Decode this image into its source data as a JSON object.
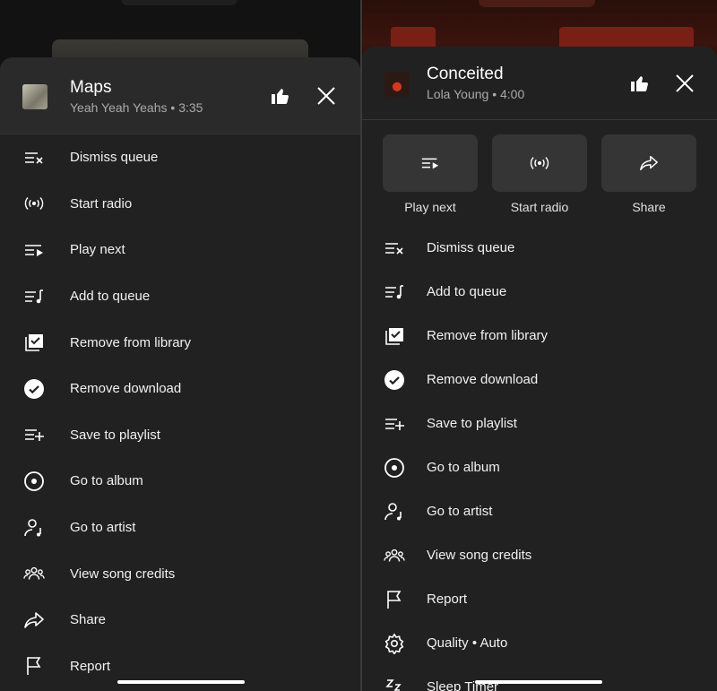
{
  "left": {
    "song": {
      "title": "Maps",
      "subtitle": "Yeah Yeah Yeahs • 3:35"
    },
    "menu": [
      {
        "label": "Dismiss queue",
        "icon": "dismiss-queue-icon"
      },
      {
        "label": "Start radio",
        "icon": "radio-icon"
      },
      {
        "label": "Play next",
        "icon": "play-next-icon"
      },
      {
        "label": "Add to queue",
        "icon": "add-to-queue-icon"
      },
      {
        "label": "Remove from library",
        "icon": "library-check-icon"
      },
      {
        "label": "Remove download",
        "icon": "download-check-icon"
      },
      {
        "label": "Save to playlist",
        "icon": "playlist-add-icon"
      },
      {
        "label": "Go to album",
        "icon": "album-icon"
      },
      {
        "label": "Go to artist",
        "icon": "artist-icon"
      },
      {
        "label": "View song credits",
        "icon": "credits-icon"
      },
      {
        "label": "Share",
        "icon": "share-icon"
      },
      {
        "label": "Report",
        "icon": "flag-icon"
      }
    ]
  },
  "right": {
    "song": {
      "title": "Conceited",
      "subtitle": "Lola Young • 4:00"
    },
    "quick_actions": [
      {
        "label": "Play next",
        "icon": "play-next-icon"
      },
      {
        "label": "Start radio",
        "icon": "radio-icon"
      },
      {
        "label": "Share",
        "icon": "share-icon"
      }
    ],
    "menu": [
      {
        "label": "Dismiss queue",
        "icon": "dismiss-queue-icon"
      },
      {
        "label": "Add to queue",
        "icon": "add-to-queue-icon"
      },
      {
        "label": "Remove from library",
        "icon": "library-check-icon"
      },
      {
        "label": "Remove download",
        "icon": "download-check-icon"
      },
      {
        "label": "Save to playlist",
        "icon": "playlist-add-icon"
      },
      {
        "label": "Go to album",
        "icon": "album-icon"
      },
      {
        "label": "Go to artist",
        "icon": "artist-icon"
      },
      {
        "label": "View song credits",
        "icon": "credits-icon"
      },
      {
        "label": "Report",
        "icon": "flag-icon"
      },
      {
        "label": "Quality • Auto",
        "icon": "gear-icon"
      },
      {
        "label": "Sleep Timer",
        "icon": "sleep-timer-icon"
      }
    ]
  },
  "colors": {
    "sheet": "#212121",
    "header": "#2a2a2a",
    "text": "#ffffff",
    "subtext": "#aaaaaa",
    "quick_box": "#353535"
  }
}
